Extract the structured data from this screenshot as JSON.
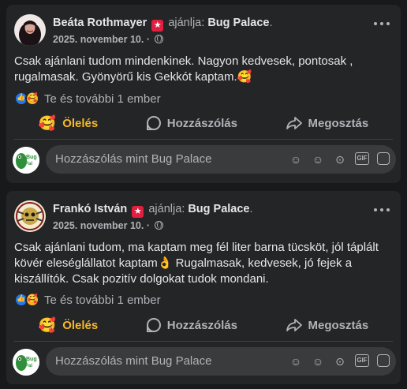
{
  "posts": [
    {
      "author": "Beáta Rothmayer",
      "recommends": "ajánlja:",
      "page": "Bug Palace",
      "period": ".",
      "date": "2025. november 10. ·",
      "text": "Csak ajánlani tudom mindenkinek. Nagyon kedvesek, pontosak , rugalmasak. Gyönyörű kis Gekkót kaptam.🥰",
      "reactions_text": "Te és további 1 ember",
      "actions": {
        "care": "Ölelés",
        "comment": "Hozzászólás",
        "share": "Megosztás"
      },
      "comment_placeholder": "Hozzászólás mint Bug Palace"
    },
    {
      "author": "Frankó István",
      "recommends": "ajánlja:",
      "page": "Bug Palace",
      "period": ".",
      "date": "2025. november 10. ·",
      "text": "Csak ajánlani tudom, ma kaptam meg fél liter barna tücsköt, jól táplált kövér eleséglállatot kaptam👌 Rugalmasak, kedvesek, jó fejek a kiszállítók. Csak pozitív dolgokat tudok mondani.",
      "reactions_text": "Te és további 1 ember",
      "actions": {
        "care": "Ölelés",
        "comment": "Hozzászólás",
        "share": "Megosztás"
      },
      "comment_placeholder": "Hozzászólás mint Bug Palace"
    }
  ],
  "commenter_avatar_text": "Bug Palace",
  "colors": {
    "background": "#18191a",
    "card": "#242526",
    "care": "#f7b928",
    "like": "#2078f4",
    "badge": "#e41e3f"
  }
}
